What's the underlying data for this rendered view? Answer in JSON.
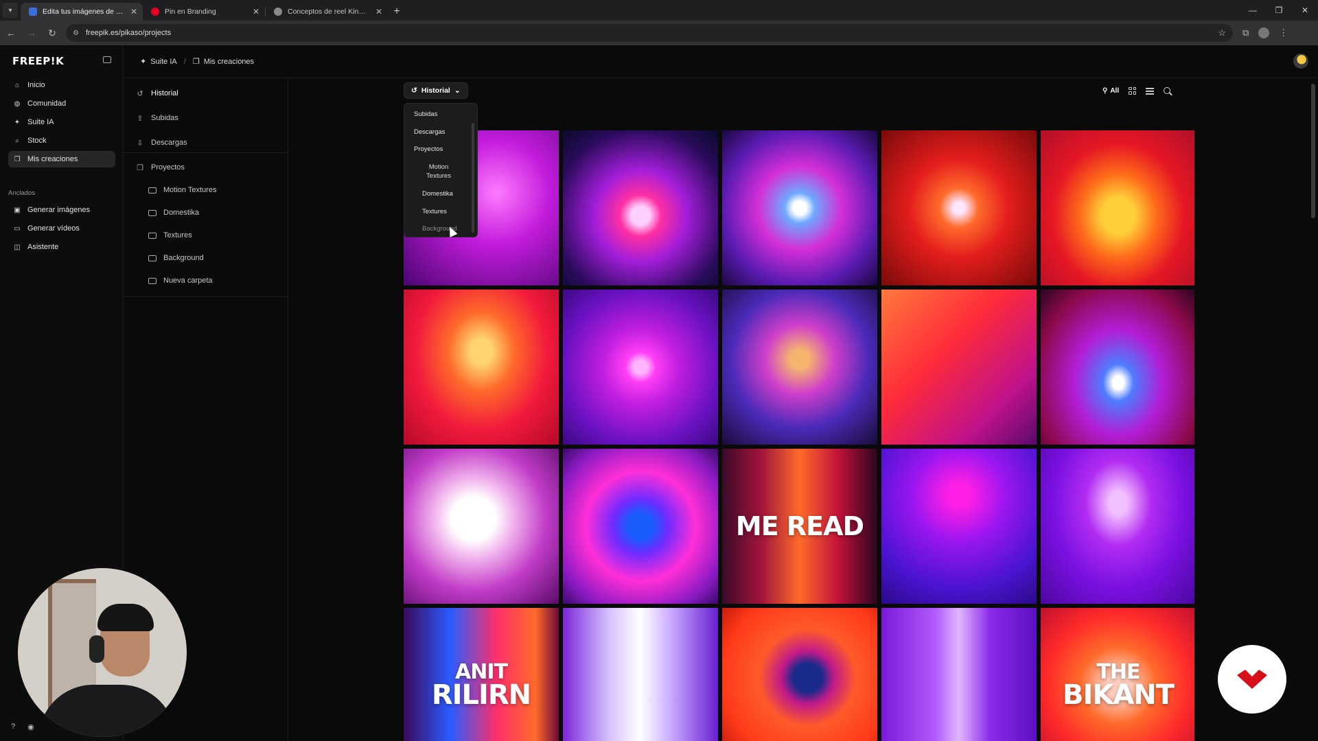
{
  "browser": {
    "tabs": [
      {
        "title": "Edita tus imágenes de manera g",
        "fav_color": "#3b6fe0",
        "active": true
      },
      {
        "title": "Pin en Branding",
        "fav_color": "#e60023",
        "active": false
      },
      {
        "title": "Conceptos de reel Kinetic",
        "fav_color": "#8a8a8a",
        "active": false
      }
    ],
    "url": "freepik.es/pikaso/projects"
  },
  "sidebar": {
    "logo": "FREEP!K",
    "nav": [
      {
        "label": "Inicio",
        "icon": "home-icon",
        "glyph": "⌂"
      },
      {
        "label": "Comunidad",
        "icon": "globe-icon",
        "glyph": "◍"
      },
      {
        "label": "Suite IA",
        "icon": "sparkle-icon",
        "glyph": "✦"
      },
      {
        "label": "Stock",
        "icon": "search-icon",
        "glyph": "⌕"
      },
      {
        "label": "Mis creaciones",
        "icon": "gallery-icon",
        "glyph": "❐"
      }
    ],
    "pinned_label": "Anclados",
    "pinned": [
      {
        "label": "Generar imágenes",
        "icon": "image-icon",
        "glyph": "▣"
      },
      {
        "label": "Generar vídeos",
        "icon": "video-icon",
        "glyph": "▭"
      },
      {
        "label": "Asistente",
        "icon": "chat-icon",
        "glyph": "◫"
      }
    ]
  },
  "breadcrumb": {
    "root": "Suite IA",
    "separator": "/",
    "current": "Mis creaciones"
  },
  "panel": {
    "items": [
      {
        "label": "Historial",
        "icon": "history-icon",
        "glyph": "↺"
      },
      {
        "label": "Subidas",
        "icon": "upload-icon",
        "glyph": "⇪"
      },
      {
        "label": "Descargas",
        "icon": "download-icon",
        "glyph": "⇩"
      },
      {
        "label": "Proyectos",
        "icon": "projects-icon",
        "glyph": "❐"
      }
    ],
    "folders": [
      "Motion Textures",
      "Domestika",
      "Textures",
      "Background",
      "Nueva carpeta"
    ]
  },
  "toolbar": {
    "history_label": "Historial",
    "filter_label": "All"
  },
  "dropdown": {
    "items": [
      "Subidas",
      "Descargas",
      "Proyectos"
    ],
    "sub_items": [
      "Motion Textures",
      "Domestika",
      "Textures",
      "Background"
    ]
  },
  "tiles": [
    {
      "bg": "radial-gradient(circle at 60% 40%, #ff7bff 0%, #c21bdb 40%, #4a0670 100%)",
      "text": ""
    },
    {
      "bg": "radial-gradient(circle at 50% 55%, #ffd0ff 0 8%, #ff2fa3 18%, #a21ed9 40%, #2a0b5c 75%, #0a0a2a 100%)",
      "text": ""
    },
    {
      "bg": "radial-gradient(circle at 50% 50%, #ffffff 0 6%, #6ea8ff 14%, #d42fd8 38%, #5b1bb2 70%, #1a0840 100%)",
      "text": ""
    },
    {
      "bg": "radial-gradient(circle at 50% 50%, #ffe7ff 0 5%, #ff6a2b 18%, #e41d1d 45%, #7a0a0a 100%)",
      "text": ""
    },
    {
      "bg": "radial-gradient(ellipse at 50% 55%, #ffcf3a 0 15%, #ff6a1a 35%, #e51724 60%, #b00f2a 100%)",
      "text": ""
    },
    {
      "bg": "radial-gradient(ellipse at 50% 40%, #ffd36e 0 10%, #ff6a2a 30%, #f21a3c 60%, #b50a2a 100%)",
      "text": ""
    },
    {
      "bg": "radial-gradient(circle at 50% 50%, #ffb6ff 0 6%, #ff3df5 14%, #c01ee0 35%, #6a11c2 70%, #3b0a82 100%)",
      "text": ""
    },
    {
      "bg": "radial-gradient(circle at 50% 45%, #f6b46e 0 8%, #cf3fcb 30%, #4a2ab8 60%, #1a0c3a 100%)",
      "text": ""
    },
    {
      "bg": "linear-gradient(135deg, #ff7a3c 0%, #ff2a3a 40%, #c0128a 75%, #5a0a6a 100%)",
      "text": ""
    },
    {
      "bg": "radial-gradient(ellipse at 50% 60%, #ffffff 0 5%, #4f7cff 14%, #b21ed6 40%, #8a0a4a 75%, #2a0620 100%)",
      "text": ""
    },
    {
      "bg": "radial-gradient(circle at 45% 45%, #ffffff 0 18%, #f2b8ee 32%, #c23cc8 60%, #5a0b6a 100%)",
      "text": ""
    },
    {
      "bg": "radial-gradient(circle at 50% 50%, #1a5cff 0 12%, #6f2bff 25%, #ff2fd8 50%, #8a1ac2 80%, #3a0a6a 100%)",
      "text": ""
    },
    {
      "bg": "linear-gradient(90deg, #3a0a2a 0%, #a0143a 25%, #ff6a2a 50%, #c0123a 75%, #2a0620 100%)",
      "text": "ME READ"
    },
    {
      "bg": "radial-gradient(circle at 50% 30%, #ff1fe6 0 8%, #9a16f0 35%, #4a14d0 70%, #2a0a8a 100%)",
      "text": ""
    },
    {
      "bg": "radial-gradient(ellipse at 50% 35%, #f3c0ff 0 8%, #b12cf2 30%, #7a10e0 60%, #4a08a0 100%)",
      "text": ""
    },
    {
      "bg": "linear-gradient(90deg, #3a0a5a 0%, #2a5cff 30%, #ff2f6a 60%, #ff6a2a 85%, #6a0a3a 100%)",
      "text": "ANIT\nRILIRN"
    },
    {
      "bg": "linear-gradient(90deg, #7a28d8 0%, #d9c2ff 30%, #ffffff 50%, #c8a8ff 70%, #6a1ed2 100%)",
      "text": ""
    },
    {
      "bg": "radial-gradient(circle at 55% 45%, #1a2a8a 0 12%, #c01a8a 22%, #ff5a2a 40%, #ff3a1a 70%, #b0100a 100%)",
      "text": ""
    },
    {
      "bg": "linear-gradient(90deg, #7a1ad8 0%, #b25bff 35%, #e1b6ff 50%, #8a2ae8 70%, #5a10c0 100%)",
      "text": ""
    },
    {
      "bg": "radial-gradient(ellipse at 50% 50%, #ffd0c0 0 10%, #ff6a2a 35%, #ff2a2a 65%, #c01030 100%)",
      "text": "THE\nBIKANT"
    }
  ]
}
